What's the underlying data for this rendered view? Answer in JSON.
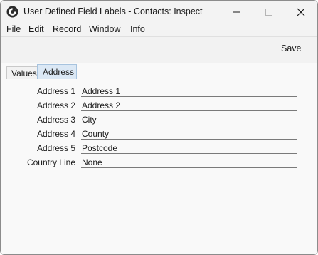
{
  "window": {
    "title": "User Defined Field Labels - Contacts: Inspect",
    "app_icon": "app-icon",
    "controls": [
      "minimize-icon",
      "maximize-icon",
      "close-icon"
    ]
  },
  "menu": [
    "File",
    "Edit",
    "Record",
    "Window",
    "Info"
  ],
  "toolbar": {
    "save_label": "Save"
  },
  "tabs": [
    {
      "label": "Values",
      "active": false
    },
    {
      "label": "Address",
      "active": true
    }
  ],
  "fields": [
    {
      "label": "Address 1",
      "value": "Address 1"
    },
    {
      "label": "Address 2",
      "value": "Address 2"
    },
    {
      "label": "Address 3",
      "value": "City"
    },
    {
      "label": "Address 4",
      "value": "County"
    },
    {
      "label": "Address 5",
      "value": "Postcode"
    },
    {
      "label": "Country Line",
      "value": "None"
    }
  ],
  "colors": {
    "active_tab_bg": "#dbe8f5",
    "active_tab_border": "#a7c3de",
    "window_bg": "#f9f9f9",
    "toolbar_bg": "#f2f2f2"
  }
}
